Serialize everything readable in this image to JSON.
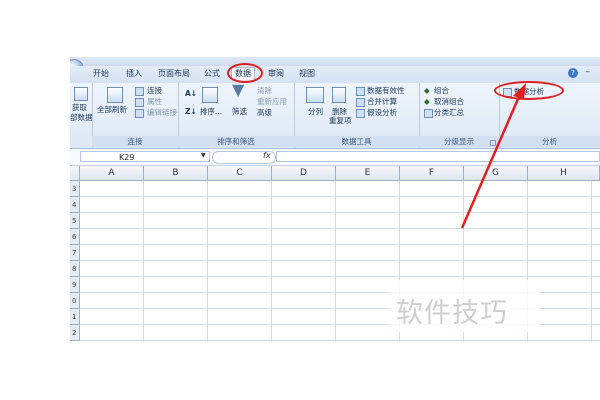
{
  "tabs": [
    "开始",
    "插入",
    "页面布局",
    "公式",
    "数据",
    "审阅",
    "视图"
  ],
  "active_tab": "数据",
  "ribbon": {
    "get_external": [
      "获取",
      "部数据"
    ],
    "connections": {
      "refresh_all": "全部刷新",
      "connections": "连接",
      "properties": "属性",
      "edit_links": "编辑链接",
      "label": "连接"
    },
    "sort_filter": {
      "sort": "排序...",
      "filter": "筛选",
      "clear": "清除",
      "reapply": "重新应用",
      "advanced": "高级",
      "label": "排序和筛选"
    },
    "data_tools": {
      "text_to_columns": "分列",
      "remove_duplicates": [
        "删除",
        "重复项"
      ],
      "data_validation": "数据有效性",
      "consolidate": "合并计算",
      "what_if": "假设分析",
      "label": "数据工具"
    },
    "outline": {
      "group": "组合",
      "ungroup": "取消组合",
      "subtotal": "分类汇总",
      "label": "分级显示"
    },
    "analysis": {
      "data_analysis": "数据分析",
      "label": "分析"
    }
  },
  "formula_bar": {
    "name_box": "K29",
    "fx": "fx"
  },
  "columns": [
    "A",
    "B",
    "C",
    "D",
    "E",
    "F",
    "G",
    "H"
  ],
  "row_labels": [
    "3",
    "4",
    "5",
    "6",
    "7",
    "8",
    "9",
    "0",
    "1",
    "2"
  ],
  "watermark": "软件技巧",
  "annotation_color": "#e02020"
}
